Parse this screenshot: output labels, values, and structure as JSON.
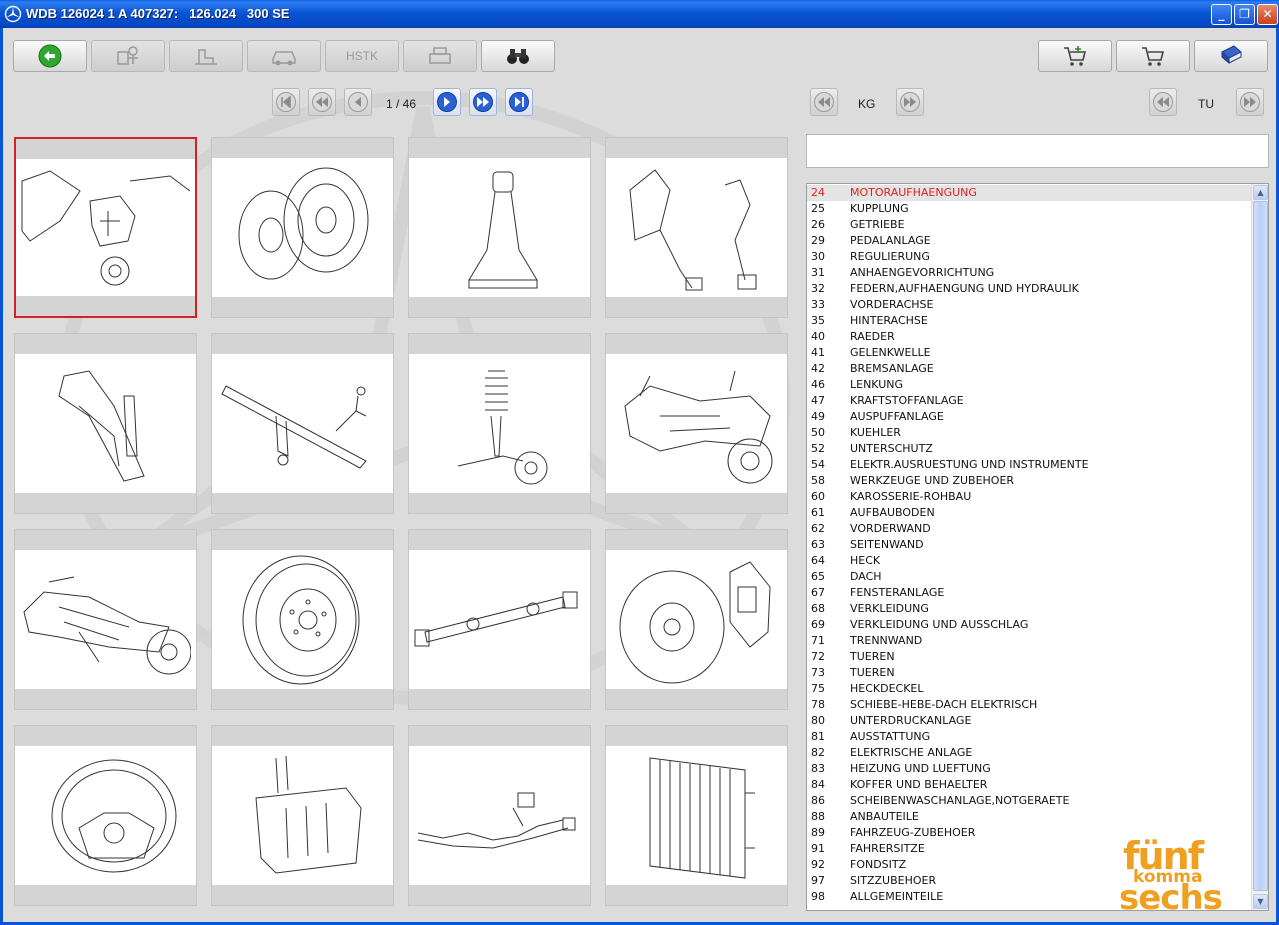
{
  "window": {
    "title": "WDB 126024 1 A 407327:   126.024   300 SE",
    "minimize": "_",
    "maximize": "❐",
    "close": "✕"
  },
  "toolbar": {
    "back_icon": "back-arrow-icon",
    "hstk_label": "HSTK"
  },
  "pager": {
    "page_text": "1 / 46"
  },
  "kg_nav": {
    "label": "KG"
  },
  "tu_nav": {
    "label": "TU"
  },
  "search": {
    "value": ""
  },
  "colors": {
    "selected_text": "#e02020",
    "selected_border": "#d32020",
    "logo": "#f0a020",
    "titlebar": "#0a55d6"
  },
  "thumbnails": [
    {
      "icon": "engine-mount-icon",
      "selected": true
    },
    {
      "icon": "clutch-icon"
    },
    {
      "icon": "gear-shift-boot-icon"
    },
    {
      "icon": "pedal-assembly-icon"
    },
    {
      "icon": "regulating-linkage-icon"
    },
    {
      "icon": "tow-hitch-icon"
    },
    {
      "icon": "spring-strut-icon"
    },
    {
      "icon": "front-axle-icon"
    },
    {
      "icon": "rear-axle-icon"
    },
    {
      "icon": "wheel-rim-icon"
    },
    {
      "icon": "propeller-shaft-icon"
    },
    {
      "icon": "brake-disc-icon"
    },
    {
      "icon": "steering-wheel-icon"
    },
    {
      "icon": "fuel-tank-icon"
    },
    {
      "icon": "exhaust-system-icon"
    },
    {
      "icon": "radiator-icon"
    }
  ],
  "groups": [
    {
      "num": "24",
      "name": "MOTORAUFHAENGUNG",
      "selected": true
    },
    {
      "num": "25",
      "name": "KUPPLUNG"
    },
    {
      "num": "26",
      "name": "GETRIEBE"
    },
    {
      "num": "29",
      "name": "PEDALANLAGE"
    },
    {
      "num": "30",
      "name": "REGULIERUNG"
    },
    {
      "num": "31",
      "name": "ANHAENGEVORRICHTUNG"
    },
    {
      "num": "32",
      "name": "FEDERN,AUFHAENGUNG UND HYDRAULIK"
    },
    {
      "num": "33",
      "name": "VORDERACHSE"
    },
    {
      "num": "35",
      "name": "HINTERACHSE"
    },
    {
      "num": "40",
      "name": "RAEDER"
    },
    {
      "num": "41",
      "name": "GELENKWELLE"
    },
    {
      "num": "42",
      "name": "BREMSANLAGE"
    },
    {
      "num": "46",
      "name": "LENKUNG"
    },
    {
      "num": "47",
      "name": "KRAFTSTOFFANLAGE"
    },
    {
      "num": "49",
      "name": "AUSPUFFANLAGE"
    },
    {
      "num": "50",
      "name": "KUEHLER"
    },
    {
      "num": "52",
      "name": "UNTERSCHUTZ"
    },
    {
      "num": "54",
      "name": "ELEKTR.AUSRUESTUNG UND INSTRUMENTE"
    },
    {
      "num": "58",
      "name": "WERKZEUGE UND ZUBEHOER"
    },
    {
      "num": "60",
      "name": "KAROSSERIE-ROHBAU"
    },
    {
      "num": "61",
      "name": "AUFBAUBODEN"
    },
    {
      "num": "62",
      "name": "VORDERWAND"
    },
    {
      "num": "63",
      "name": "SEITENWAND"
    },
    {
      "num": "64",
      "name": "HECK"
    },
    {
      "num": "65",
      "name": "DACH"
    },
    {
      "num": "67",
      "name": "FENSTERANLAGE"
    },
    {
      "num": "68",
      "name": "VERKLEIDUNG"
    },
    {
      "num": "69",
      "name": "VERKLEIDUNG UND AUSSCHLAG"
    },
    {
      "num": "71",
      "name": "TRENNWAND"
    },
    {
      "num": "72",
      "name": "TUEREN"
    },
    {
      "num": "73",
      "name": "TUEREN"
    },
    {
      "num": "75",
      "name": "HECKDECKEL"
    },
    {
      "num": "78",
      "name": "SCHIEBE-HEBE-DACH ELEKTRISCH"
    },
    {
      "num": "80",
      "name": "UNTERDRUCKANLAGE"
    },
    {
      "num": "81",
      "name": "AUSSTATTUNG"
    },
    {
      "num": "82",
      "name": "ELEKTRISCHE ANLAGE"
    },
    {
      "num": "83",
      "name": "HEIZUNG UND LUEFTUNG"
    },
    {
      "num": "84",
      "name": "KOFFER UND BEHAELTER"
    },
    {
      "num": "86",
      "name": "SCHEIBENWASCHANLAGE,NOTGERAETE"
    },
    {
      "num": "88",
      "name": "ANBAUTEILE"
    },
    {
      "num": "89",
      "name": "FAHRZEUG-ZUBEHOER"
    },
    {
      "num": "91",
      "name": "FAHRERSITZE"
    },
    {
      "num": "92",
      "name": "FONDSITZ"
    },
    {
      "num": "97",
      "name": "SITZZUBEHOER"
    },
    {
      "num": "98",
      "name": "ALLGEMEINTEILE"
    }
  ],
  "logo": {
    "line1": "fünf",
    "line2": "komma",
    "line3": "sechs"
  }
}
